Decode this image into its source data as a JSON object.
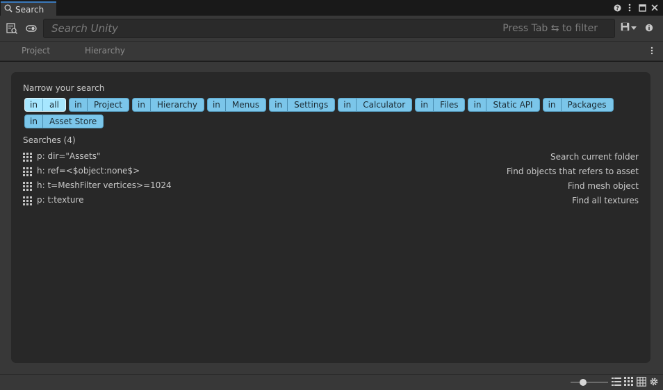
{
  "window": {
    "tab_title": "Search"
  },
  "toolbar": {
    "search_placeholder": "Search Unity",
    "search_value": "",
    "hint": "Press Tab ⇆ to filter"
  },
  "provider_tabs": [
    {
      "label": "Project"
    },
    {
      "label": "Hierarchy"
    }
  ],
  "narrow": {
    "title": "Narrow your search",
    "chips": [
      {
        "prefix": "in",
        "label": "all",
        "active": true
      },
      {
        "prefix": "in",
        "label": "Project"
      },
      {
        "prefix": "in",
        "label": "Hierarchy"
      },
      {
        "prefix": "in",
        "label": "Menus"
      },
      {
        "prefix": "in",
        "label": "Settings"
      },
      {
        "prefix": "in",
        "label": "Calculator"
      },
      {
        "prefix": "in",
        "label": "Files"
      },
      {
        "prefix": "in",
        "label": "Static API"
      },
      {
        "prefix": "in",
        "label": "Packages"
      },
      {
        "prefix": "in",
        "label": "Asset Store"
      }
    ]
  },
  "searches": {
    "title": "Searches (4)",
    "items": [
      {
        "query": "p: dir=\"Assets\"",
        "desc": "Search current folder"
      },
      {
        "query": "h: ref=<$object:none$>",
        "desc": "Find objects that refers to asset"
      },
      {
        "query": "h: t=MeshFilter vertices>=1024",
        "desc": "Find mesh object"
      },
      {
        "query": "p: t:texture",
        "desc": "Find all textures"
      }
    ]
  },
  "status": {
    "item_size_fraction": 0.3
  },
  "colors": {
    "chip": "#7bc6ea",
    "chip_active": "#a7e7ff",
    "tab_accent": "#3a79bb",
    "panel": "#282828"
  },
  "icons": [
    "search-icon",
    "help-icon",
    "more-vert-icon",
    "maximize-icon",
    "close-icon",
    "search-queries-icon",
    "toggle-icon",
    "save-icon",
    "info-icon",
    "kebab-icon",
    "list-view-icon",
    "grid-view-icon",
    "table-view-icon",
    "settings-icon",
    "drag-grip-icon"
  ]
}
